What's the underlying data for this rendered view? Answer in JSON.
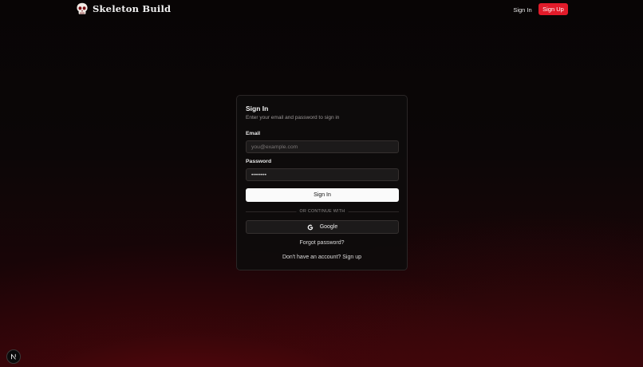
{
  "header": {
    "brand_name": "Skeleton Build",
    "logo_icon": "skull-icon",
    "signin_label": "Sign In",
    "signup_label": "Sign Up",
    "accent_color": "#e21b2a"
  },
  "card": {
    "title": "Sign In",
    "subtitle": "Enter your email and password to sign in",
    "email_label": "Email",
    "email_placeholder": "you@example.com",
    "email_value": "",
    "password_label": "Password",
    "password_value": "••••••••",
    "submit_label": "Sign In",
    "divider_text": "OR CONTINUE WITH",
    "google_icon": "google-icon",
    "google_label": "Google",
    "forgot_label": "Forgot password?",
    "no_account_text": "Don't have an account?",
    "signup_link_label": "Sign up"
  },
  "devtools": {
    "badge_icon": "nextjs-icon"
  }
}
